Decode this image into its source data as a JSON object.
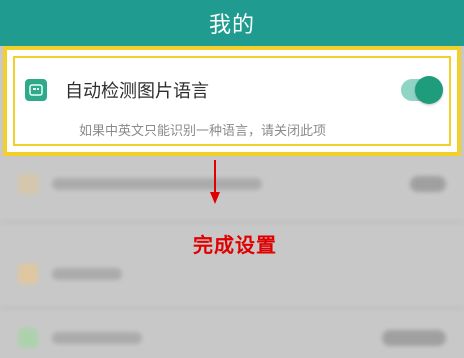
{
  "header": {
    "title": "我的"
  },
  "setting": {
    "title": "自动检测图片语言",
    "subtitle": "如果中英文只能识别一种语言，请关闭此项",
    "toggle_on": true
  },
  "annotation": {
    "text": "完成设置"
  },
  "colors": {
    "topbar": "#1f9c8f",
    "highlight": "#f2cf2a",
    "toggle_knob": "#1f9c7c",
    "annotation": "#e00000"
  },
  "icons": {
    "setting_icon": "image-language-icon",
    "arrow": "down-arrow-icon"
  }
}
